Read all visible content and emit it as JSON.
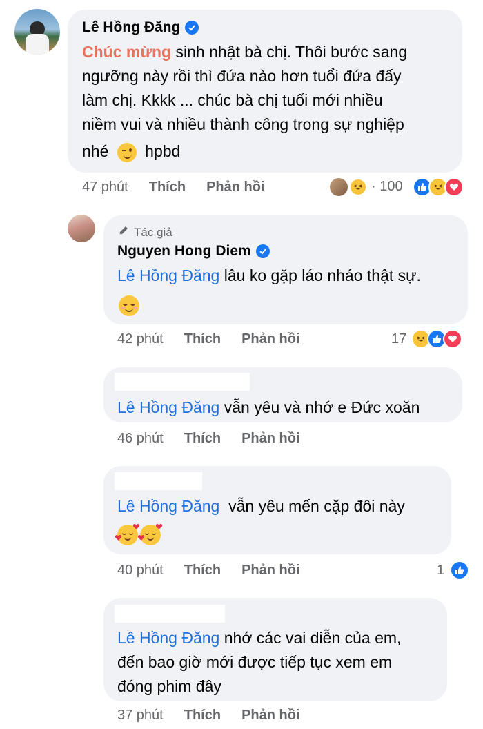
{
  "comments": [
    {
      "author": "Lê Hồng Đăng",
      "highlight": "Chúc mừng",
      "lines": [
        "sinh nhật bà chị. Thôi bước sang",
        "ngưỡng này rồi thì đứa nào hơn tuổi đứa đấy",
        "làm chị. Kkkk ... chúc bà chị tuổi mới nhiều",
        "niềm vui và nhiều thành công trong sự nghiệp",
        "nhé",
        "hpbd"
      ],
      "time": "47 phút",
      "like": "Thích",
      "reply": "Phản hồi",
      "reaction_count": "· 100"
    },
    {
      "author_badge": "Tác giả",
      "author": "Nguyen Hong Diem",
      "mention": "Lê Hồng Đăng",
      "text": "lâu ko gặp láo nháo thật sự.",
      "time": "42 phút",
      "like": "Thích",
      "reply": "Phản hồi",
      "reaction_count": "17"
    },
    {
      "mention": "Lê Hồng Đăng",
      "text": "vẫn yêu và nhớ e Đức xoăn",
      "time": "46 phút",
      "like": "Thích",
      "reply": "Phản hồi"
    },
    {
      "mention": "Lê Hồng Đăng",
      "text": "vẫn yêu mến cặp đôi này",
      "time": "40 phút",
      "like": "Thích",
      "reply": "Phản hồi",
      "reaction_count": "1"
    },
    {
      "mention": "Lê Hồng Đăng",
      "text_line1": "nhớ các vai diễn của em,",
      "text_line2": "đến bao giờ mới được tiếp tục xem em",
      "text_line3": "đóng phim đây",
      "time": "37 phút",
      "like": "Thích",
      "reply": "Phản hồi"
    }
  ],
  "icons": [
    "verified-badge-icon",
    "pencil-icon",
    "like-reaction-icon",
    "haha-reaction-icon",
    "love-reaction-icon",
    "wink-emoji-icon",
    "smiling-emoji-icon",
    "hearts-emoji-icon"
  ],
  "colors": {
    "bubble": "#f0f2f5",
    "mention": "#216fdb",
    "highlight": "#e8735e",
    "meta": "#65676b",
    "like": "#1877f2",
    "love": "#f33e58"
  }
}
